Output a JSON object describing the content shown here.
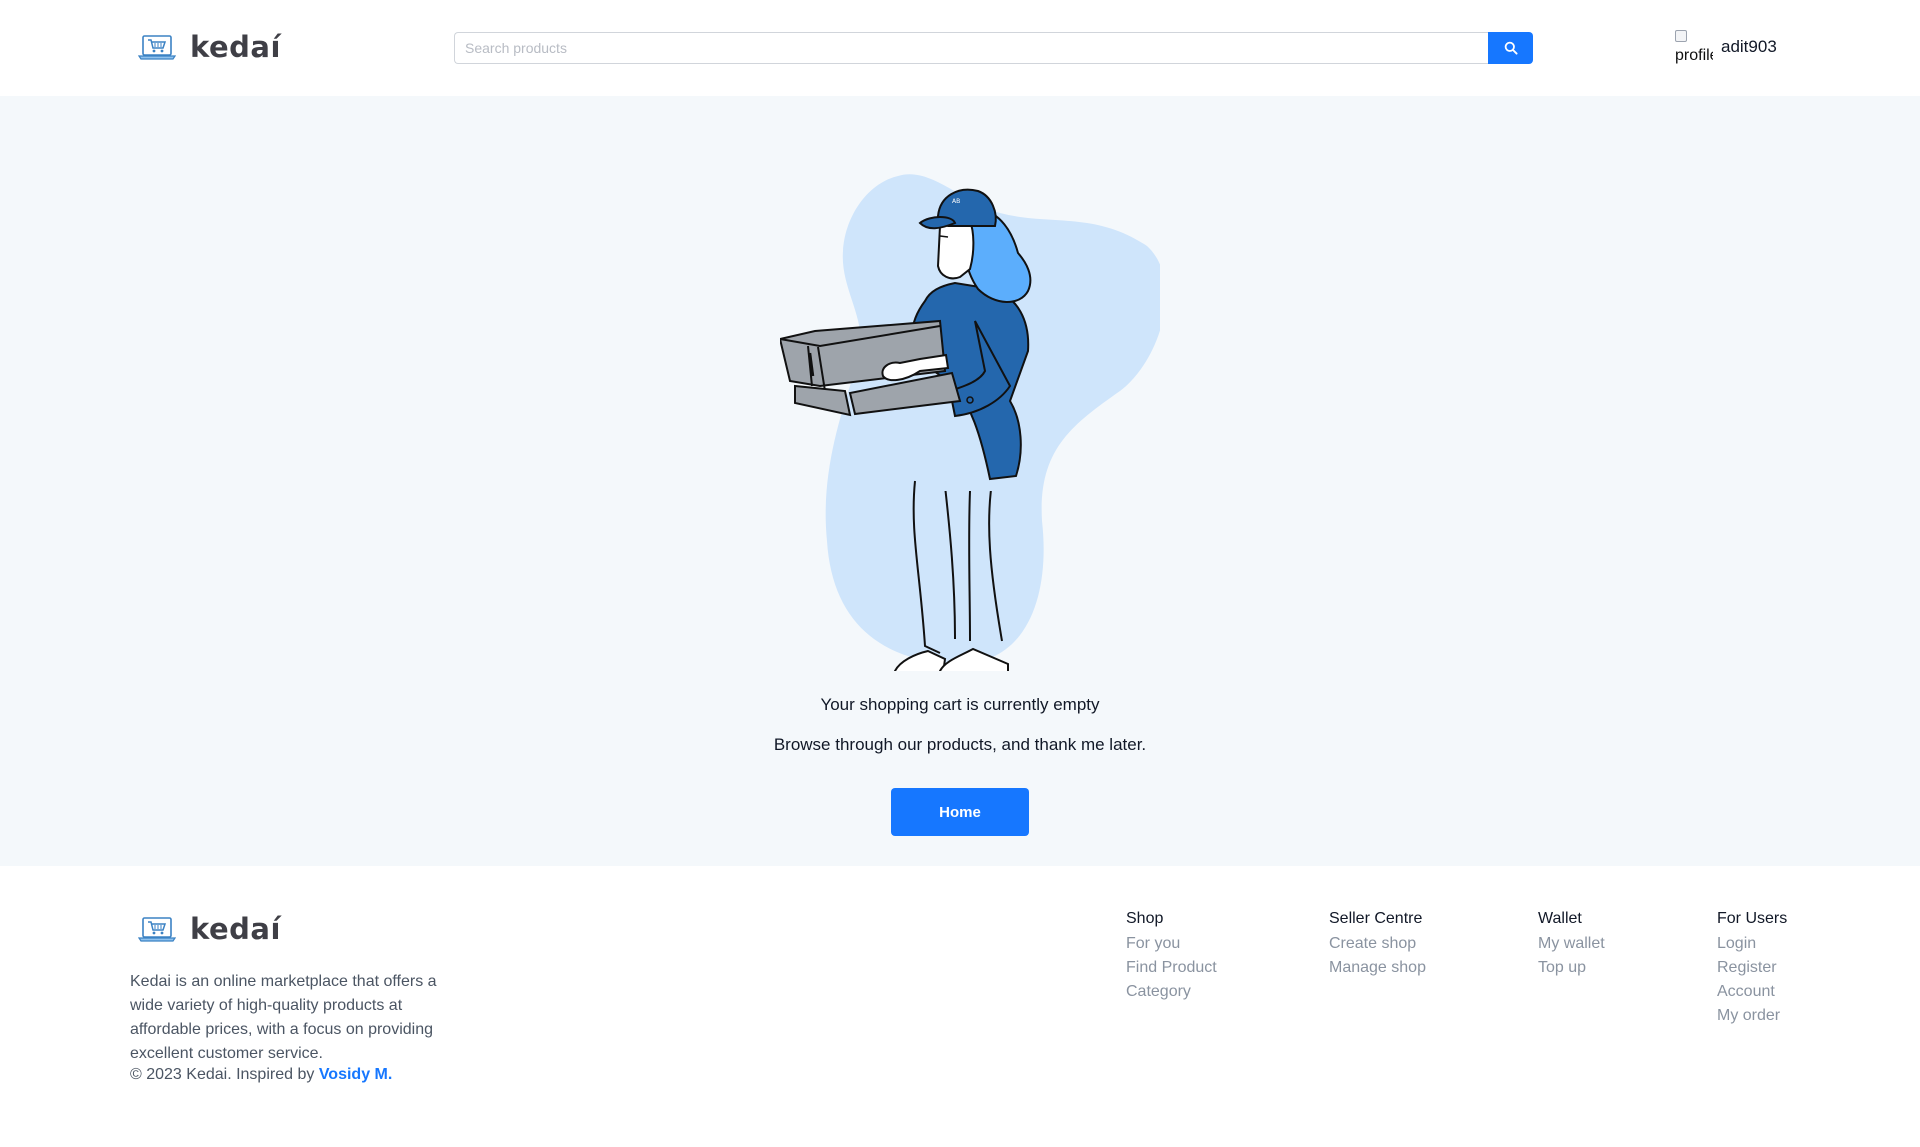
{
  "brand": {
    "name": "kedaí",
    "accent_color": "#1677ff",
    "logo_icon": "cart-laptop-icon"
  },
  "header": {
    "search": {
      "placeholder": "Search products",
      "value": "",
      "button_icon": "search-icon"
    },
    "profile": {
      "avatar_alt": "profile",
      "username": "adit903"
    }
  },
  "main": {
    "illustration": "person-holding-empty-box",
    "title": "Your shopping cart is currently empty",
    "subtitle": "Browse through our products, and thank me later.",
    "home_button": "Home"
  },
  "footer": {
    "description": "Kedai is an online marketplace that offers a wide variety of high-quality products at affordable prices, with a focus on providing excellent customer service.",
    "copyright": "© 2023 Kedai. Inspired by",
    "credit": "Vosidy M.",
    "columns": [
      {
        "title": "Shop",
        "links": [
          "For you",
          "Find Product",
          "Category"
        ]
      },
      {
        "title": "Seller Centre",
        "links": [
          "Create shop",
          "Manage shop"
        ]
      },
      {
        "title": "Wallet",
        "links": [
          "My wallet",
          "Top up"
        ]
      },
      {
        "title": "For Users",
        "links": [
          "Login",
          "Register",
          "Account",
          "My order"
        ]
      }
    ]
  }
}
